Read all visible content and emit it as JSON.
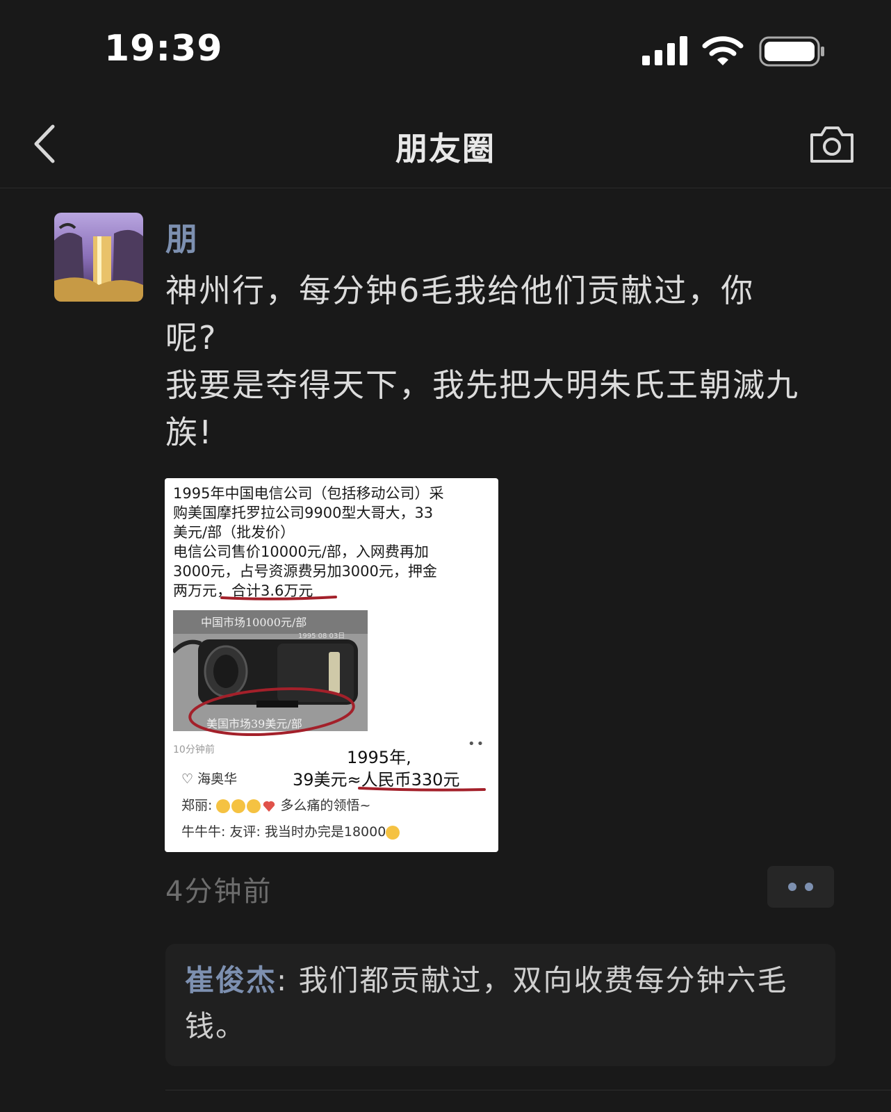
{
  "status_bar": {
    "time": "19:39"
  },
  "nav": {
    "title": "朋友圈"
  },
  "post": {
    "author": "朋",
    "text_lines": [
      "神州行，每分钟6毛我给他们贡献过，你",
      "呢?",
      "我要是夺得天下，我先把大明朱氏王朝滅九",
      "族!"
    ],
    "image": {
      "text_lines": [
        "1995年中国电信公司（包括移动公司）采",
        "购美国摩托罗拉公司9900型大哥大，33",
        "美元/部（批发价）",
        "电信公司售价10000元/部，入网费再加",
        "3000元，占号资源费另加3000元，押金",
        "两万元，合计3.6万元"
      ],
      "photo_top": "中国市场10000元/部",
      "photo_date": "1995 08 03日",
      "photo_bottom": "美国市场39美元/部",
      "inner_time": "10分钟前",
      "inner_dots": "••",
      "caption_line1": "1995年,",
      "caption_line2": "39美元≈人民币330元",
      "like": "♡ 海奥华",
      "comment1_name": "郑丽:",
      "comment1_text": "多么痛的领悟~",
      "comment2": "牛牛牛: 友评: 我当时办完是18000"
    },
    "time": "4分钟前"
  },
  "comment": {
    "name": "崔俊杰",
    "text": ": 我们都贡献过，双向收费每分钟六毛钱。"
  }
}
